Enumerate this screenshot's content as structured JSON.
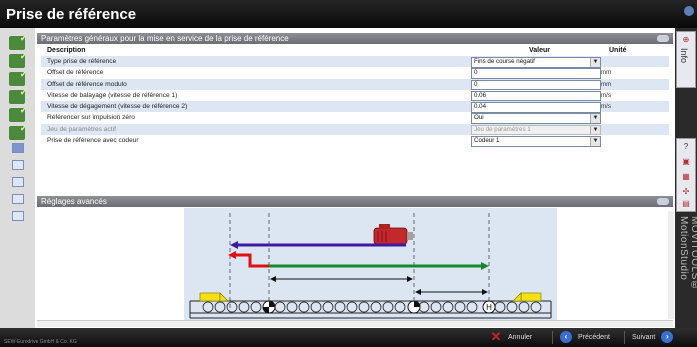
{
  "window": {
    "title": "Prise de référence"
  },
  "general_section": {
    "title": "Paramètres généraux pour la mise en service de la prise de référence",
    "columns": {
      "description": "Description",
      "value": "Valeur",
      "unit": "Unité"
    },
    "rows": [
      {
        "label": "Type prise de référence",
        "value": "Fins de course négatif",
        "unit": "",
        "dropdown": true,
        "disabled": false
      },
      {
        "label": "Offset de référence",
        "value": "0",
        "unit": "mm",
        "dropdown": false,
        "disabled": false
      },
      {
        "label": "Offset de référence modulo",
        "value": "0",
        "unit": "mm",
        "dropdown": false,
        "disabled": false
      },
      {
        "label": "Vitesse de balayage (vitesse de référence 1)",
        "value": "0.06",
        "unit": "m/s",
        "dropdown": false,
        "disabled": false
      },
      {
        "label": "Vitesse de dégagement (vitesse de référence 2)",
        "value": "0.04",
        "unit": "m/s",
        "dropdown": false,
        "disabled": false
      },
      {
        "label": "Référencer sur impulsion zéro",
        "value": "Oui",
        "unit": "",
        "dropdown": true,
        "disabled": false
      },
      {
        "label": "Jeu de paramètres actif",
        "value": "Jeu de paramètres 1",
        "unit": "",
        "dropdown": true,
        "disabled": true
      },
      {
        "label": "Prise de référence avec codeur",
        "value": "Codeur 1",
        "unit": "",
        "dropdown": true,
        "disabled": false
      }
    ]
  },
  "advanced_section": {
    "title": "Réglages avancés"
  },
  "right_sidebar": {
    "info_label": "Info",
    "vertical_brand": "MOVITOOLS® MotionStudio",
    "help_label": "?"
  },
  "footer": {
    "copyright": "SEW-Eurodrive GmbH & Co. KG",
    "cancel_label": "Annuler",
    "previous_label": "Précédent",
    "next_label": "Suivant"
  },
  "colors": {
    "accent_blue": "#3a6fd0",
    "status_green": "#4a8a3a",
    "cancel_red": "#cc2222",
    "diagram_green": "#138a2c",
    "diagram_red": "#e01010",
    "diagram_purple": "#3d1aa0"
  }
}
